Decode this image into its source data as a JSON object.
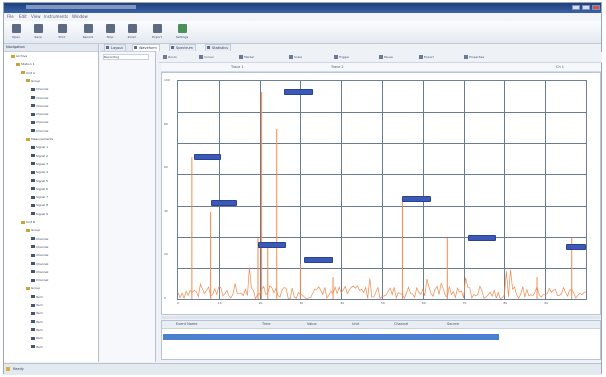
{
  "window": {
    "title": ""
  },
  "menu": [
    "File",
    "Edit",
    "View",
    "Instruments",
    "Window"
  ],
  "toolbar": [
    "Open",
    "Save",
    "Print",
    "Record",
    "Stop",
    "Zoom",
    "Export",
    "Settings",
    "Options",
    "Help"
  ],
  "tree": {
    "header": "Navigation",
    "nodes": [
      {
        "label": "Archive",
        "indent": 1,
        "icon": "folder"
      },
      {
        "label": "Station 1",
        "indent": 2,
        "icon": "folder"
      },
      {
        "label": "Unit A",
        "indent": 3,
        "icon": "folder"
      },
      {
        "label": "Group",
        "indent": 4,
        "icon": "folder"
      },
      {
        "label": "Channel",
        "indent": 5,
        "icon": "doc"
      },
      {
        "label": "Channel",
        "indent": 5,
        "icon": "doc"
      },
      {
        "label": "Channel",
        "indent": 5,
        "icon": "doc"
      },
      {
        "label": "Channel",
        "indent": 5,
        "icon": "doc"
      },
      {
        "label": "Channel",
        "indent": 5,
        "icon": "doc"
      },
      {
        "label": "Channel",
        "indent": 5,
        "icon": "doc"
      },
      {
        "label": "Measurements",
        "indent": 4,
        "icon": "folder"
      },
      {
        "label": "Signal 1",
        "indent": 5,
        "icon": "doc"
      },
      {
        "label": "Signal 2",
        "indent": 5,
        "icon": "doc"
      },
      {
        "label": "Signal 3",
        "indent": 5,
        "icon": "doc"
      },
      {
        "label": "Signal 4",
        "indent": 5,
        "icon": "doc"
      },
      {
        "label": "Signal 5",
        "indent": 5,
        "icon": "doc"
      },
      {
        "label": "Signal 6",
        "indent": 5,
        "icon": "doc"
      },
      {
        "label": "Signal 7",
        "indent": 5,
        "icon": "doc"
      },
      {
        "label": "Signal 8",
        "indent": 5,
        "icon": "doc"
      },
      {
        "label": "Signal 9",
        "indent": 5,
        "icon": "doc"
      },
      {
        "label": "Unit B",
        "indent": 3,
        "icon": "folder"
      },
      {
        "label": "Group",
        "indent": 4,
        "icon": "folder"
      },
      {
        "label": "Channel",
        "indent": 5,
        "icon": "doc"
      },
      {
        "label": "Channel",
        "indent": 5,
        "icon": "doc"
      },
      {
        "label": "Channel",
        "indent": 5,
        "icon": "doc"
      },
      {
        "label": "Channel",
        "indent": 5,
        "icon": "doc"
      },
      {
        "label": "Channel",
        "indent": 5,
        "icon": "doc"
      },
      {
        "label": "Channel",
        "indent": 5,
        "icon": "doc"
      },
      {
        "label": "Group",
        "indent": 4,
        "icon": "folder"
      },
      {
        "label": "Item",
        "indent": 5,
        "icon": "doc"
      },
      {
        "label": "Item",
        "indent": 5,
        "icon": "doc"
      },
      {
        "label": "Item",
        "indent": 5,
        "icon": "doc"
      },
      {
        "label": "Item",
        "indent": 5,
        "icon": "doc"
      },
      {
        "label": "Item",
        "indent": 5,
        "icon": "doc"
      },
      {
        "label": "Item",
        "indent": 5,
        "icon": "doc"
      },
      {
        "label": "Item",
        "indent": 5,
        "icon": "doc"
      }
    ]
  },
  "midpanel": {
    "cell": "Recording"
  },
  "tabs": [
    {
      "label": "Layout",
      "active": false
    },
    {
      "label": "Waveform",
      "active": true
    },
    {
      "label": "Spectrum",
      "active": false
    },
    {
      "label": "Statistics",
      "active": false
    }
  ],
  "chart_toolbar": [
    "Zoom",
    "Cursor",
    "Marker",
    "Scale",
    "Trigger",
    "Pause",
    "Export",
    "Properties"
  ],
  "chart_header": {
    "left": "Trace 1",
    "center": "Trace 2",
    "right": "Ch 1"
  },
  "chart_data": {
    "type": "line",
    "grid": true,
    "legend": "none",
    "xlim": [
      0,
      100
    ],
    "ylim": [
      0,
      100
    ],
    "trace_color": "#f08a4c",
    "marker_color": "#3c58b8",
    "x_ticks": [
      "0",
      "10",
      "20",
      "30",
      "40",
      "50",
      "60",
      "70",
      "80",
      "90"
    ],
    "y_ticks": [
      "100",
      "80",
      "60",
      "40",
      "20",
      "0"
    ],
    "peaks": [
      {
        "x": 3.4,
        "y": 65
      },
      {
        "x": 8.0,
        "y": 40
      },
      {
        "x": 20.5,
        "y": 95
      },
      {
        "x": 22.0,
        "y": 25
      },
      {
        "x": 19.6,
        "y": 28
      },
      {
        "x": 24.2,
        "y": 78
      },
      {
        "x": 30.0,
        "y": 16
      },
      {
        "x": 38.0,
        "y": 10
      },
      {
        "x": 55.0,
        "y": 47
      },
      {
        "x": 66.0,
        "y": 28
      },
      {
        "x": 88.0,
        "y": 10
      },
      {
        "x": 96.5,
        "y": 28
      }
    ],
    "markers": [
      {
        "x1": 4.0,
        "x2": 10.5,
        "y": 65
      },
      {
        "x1": 26.0,
        "x2": 33.0,
        "y": 95
      },
      {
        "x1": 8.0,
        "x2": 14.5,
        "y": 44
      },
      {
        "x1": 19.5,
        "x2": 26.5,
        "y": 25
      },
      {
        "x1": 31.0,
        "x2": 38.0,
        "y": 18
      },
      {
        "x1": 55.0,
        "x2": 62.0,
        "y": 46
      },
      {
        "x1": 71.0,
        "x2": 78.0,
        "y": 28
      },
      {
        "x1": 95.0,
        "x2": 100,
        "y": 24
      }
    ]
  },
  "events": {
    "columns": [
      "Event Name",
      "Time",
      "Value",
      "Unit",
      "Channel",
      "Source"
    ],
    "selected_row": ""
  },
  "status": {
    "left": "Ready",
    "mid": "",
    "right": ""
  }
}
